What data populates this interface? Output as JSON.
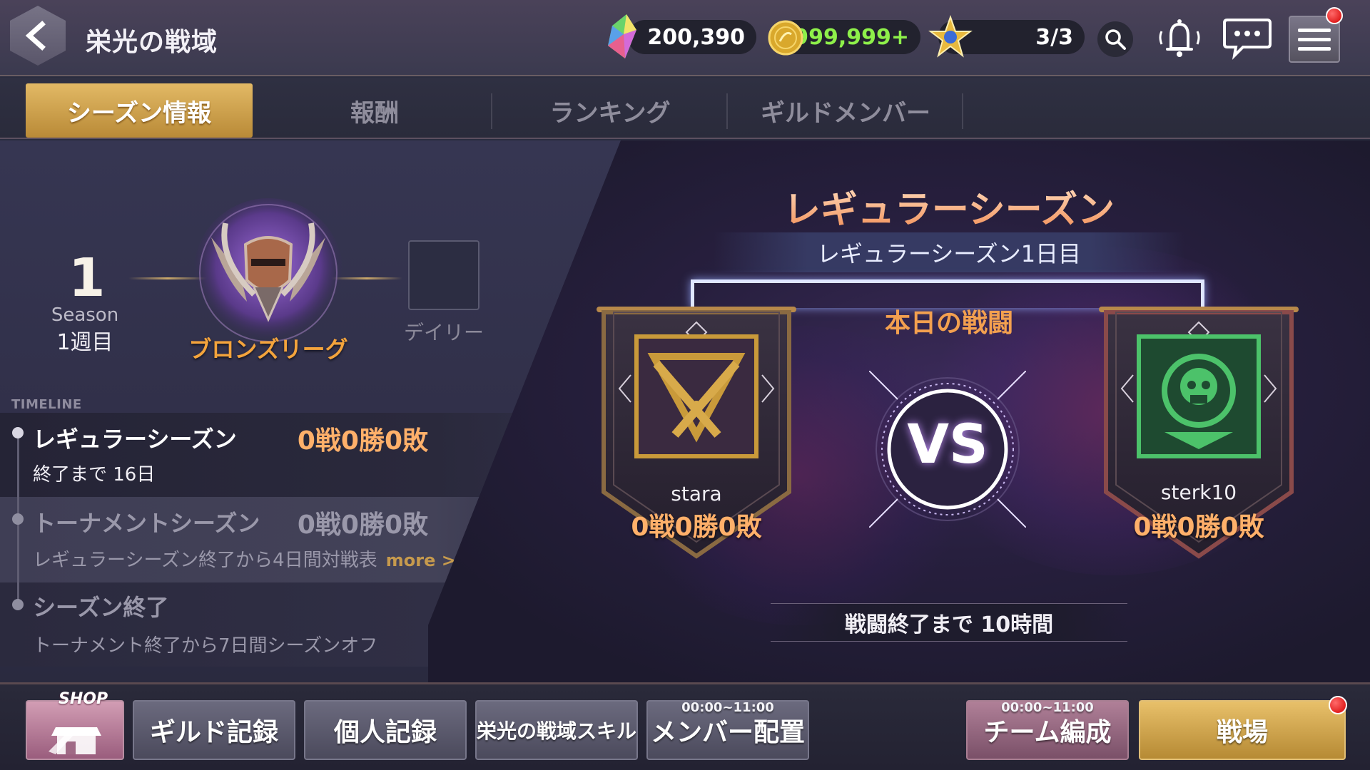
{
  "header": {
    "title": "栄光の戦域",
    "crystals": "200,390",
    "gold": "9,999,999+",
    "stamina": "3/3"
  },
  "tabs": [
    {
      "label": "シーズン情報",
      "active": true
    },
    {
      "label": "報酬",
      "active": false
    },
    {
      "label": "ランキング",
      "active": false
    },
    {
      "label": "ギルドメンバー",
      "active": false
    }
  ],
  "season": {
    "number": "1",
    "label": "Season",
    "week": "1週目",
    "league": "ブロンズリーグ",
    "daily_label": "デイリー"
  },
  "timeline": {
    "heading": "TIMELINE",
    "items": [
      {
        "title": "レギュラーシーズン",
        "record": "0戦0勝0敗",
        "sub": "終了まで 16日"
      },
      {
        "title": "トーナメントシーズン",
        "record": "0戦0勝0敗",
        "sub": "レギュラーシーズン終了から4日間対戦表",
        "more": "more >"
      },
      {
        "title": "シーズン終了",
        "record": "",
        "sub": "トーナメント終了から7日間シーズンオフ"
      }
    ]
  },
  "battle": {
    "season_title": "レギュラーシーズン",
    "day_label": "レギュラーシーズン1日目",
    "today_label": "本日の戦闘",
    "vs": "VS",
    "team_left": {
      "name": "stara",
      "record": "0戦0勝0敗"
    },
    "team_right": {
      "name": "sterk10",
      "record": "0戦0勝0敗"
    },
    "end_label": "戦闘終了まで 10時間"
  },
  "bottom": {
    "shop_label": "SHOP",
    "guild_record": "ギルド記録",
    "personal_record": "個人記録",
    "skill": "栄光の戦域スキル",
    "member_place": "メンバー配置",
    "member_place_time": "00:00~11:00",
    "team_form": "チーム編成",
    "team_form_time": "00:00~11:00",
    "battlefield": "戦場"
  },
  "colors": {
    "accent_gold": "#e2b965",
    "record_orange": "#ffb06a",
    "league_orange": "#f4a43c",
    "gold_green": "#8ef04a",
    "left_emblem": "#c28a2c",
    "right_emblem": "#3fa85a"
  },
  "icons": {
    "back": "chevron-left-icon",
    "crystal": "crystal-icon",
    "coin": "coin-icon",
    "stamina": "star-badge-icon",
    "search": "search-icon",
    "bell": "bell-icon",
    "chat": "chat-icon",
    "menu": "menu-icon",
    "shop": "shop-icon"
  }
}
